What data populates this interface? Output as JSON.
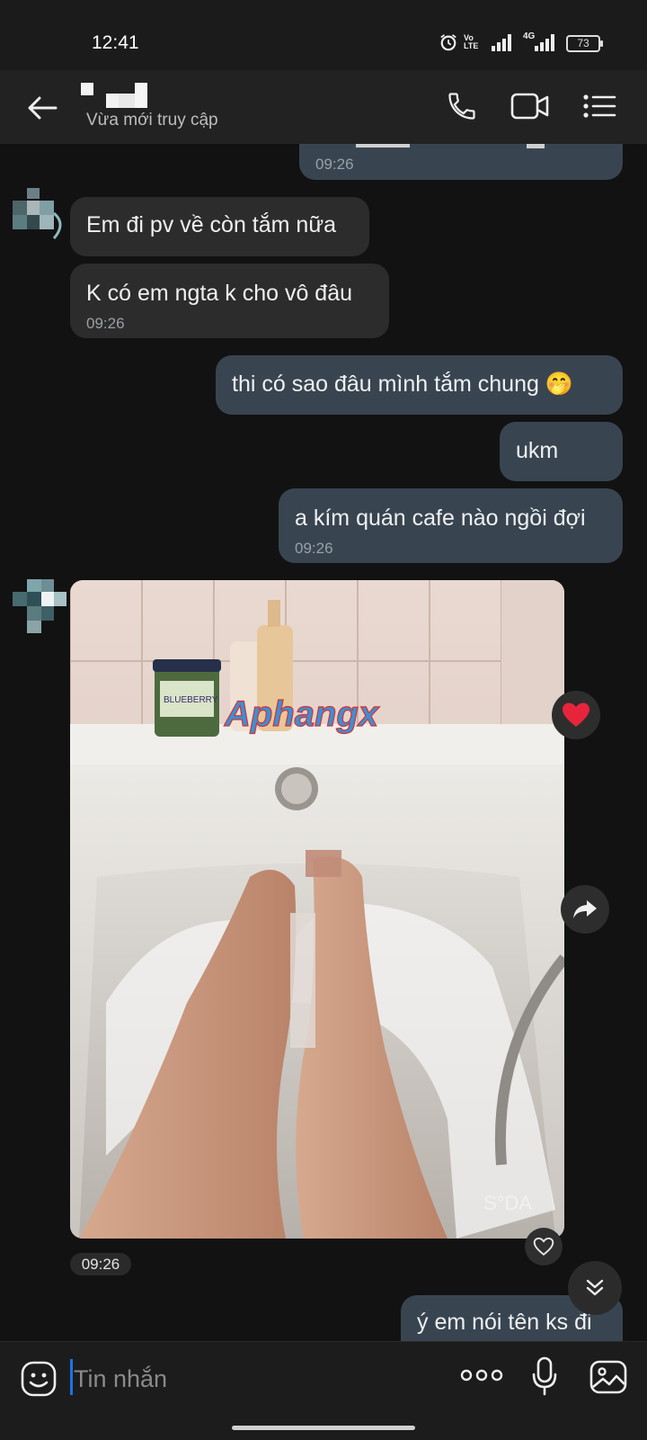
{
  "status_bar": {
    "time": "12:41",
    "volte_label": "Vo LTE",
    "network_label": "4G",
    "battery_level": "73",
    "icons": [
      "alarm-icon",
      "volte-icon",
      "signal-icon",
      "4g-signal-icon",
      "battery-icon"
    ]
  },
  "header": {
    "presence": "Vừa mới truy cập",
    "icons": [
      "back-arrow-icon",
      "phone-call-icon",
      "video-call-icon",
      "menu-list-icon"
    ]
  },
  "messages": [
    {
      "side": "sent",
      "time": "09:26",
      "text": ""
    },
    {
      "side": "received",
      "text": "Em đi pv về còn tắm nữa"
    },
    {
      "side": "received",
      "text": "K có em ngta k cho vô đâu",
      "time": "09:26"
    },
    {
      "side": "sent",
      "text": "thi có sao đâu mình tắm chung 🤭"
    },
    {
      "side": "sent",
      "text": "ukm"
    },
    {
      "side": "sent",
      "text": "a kím quán cafe nào ngồi đợi",
      "time": "09:26"
    },
    {
      "side": "received",
      "type": "photo",
      "time": "09:26",
      "reaction": "heart",
      "jar_label": "BLUEBERRY",
      "watermark": "Aphangx",
      "photo_mark": "S°DA"
    },
    {
      "side": "sent",
      "text": "ý em nói tên ks đi"
    }
  ],
  "input": {
    "placeholder": "Tin nhắn",
    "icons": [
      "emoji-icon",
      "more-dots-icon",
      "microphone-icon",
      "gallery-icon"
    ]
  },
  "colors": {
    "background": "#121212",
    "received_bubble": "#2c2c2c",
    "sent_bubble": "#384551",
    "accent": "#1a73e8",
    "heart": "#e8243c"
  }
}
